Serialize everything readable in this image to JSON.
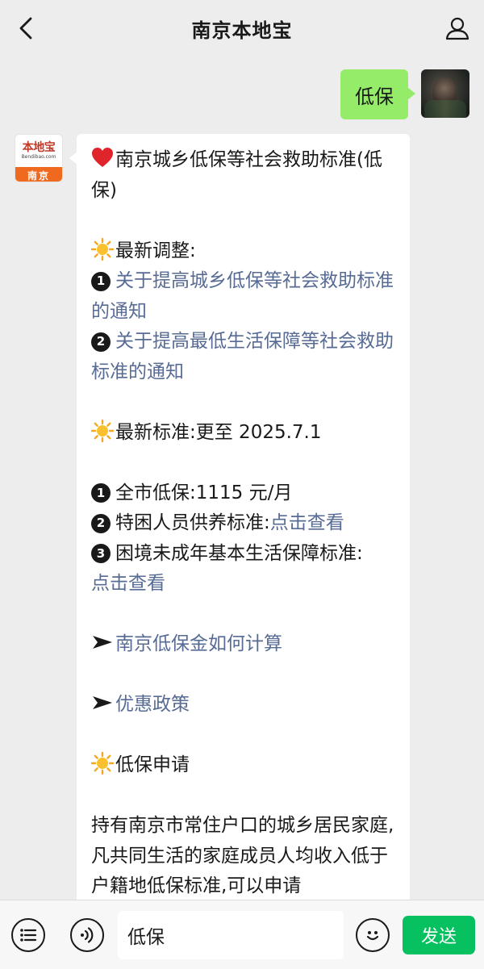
{
  "header": {
    "title": "南京本地宝"
  },
  "outgoing": {
    "text": "低保"
  },
  "brand_avatar": {
    "logo_text": "本地宝",
    "logo_sub": "Bendibao.com",
    "city": "南京"
  },
  "article": {
    "title": "南京城乡低保等社会救助标准(低保)",
    "section1_heading": "最新调整:",
    "adjust_1_num": "1",
    "adjust_1_link": "关于提高城乡低保等社会救助标准的通知",
    "adjust_2_num": "2",
    "adjust_2_link": "关于提高最低生活保障等社会救助标准的通知",
    "section2_heading": "最新标准:更至 2025.7.1",
    "std_1_num": "1",
    "std_1_text": "全市低保:1115 元/月",
    "std_2_num": "2",
    "std_2_text": "特困人员供养标准:",
    "std_2_link": "点击查看",
    "std_3_num": "3",
    "std_3_text": "困境未成年基本生活保障标准:",
    "std_3_link": "点击查看",
    "arrow_link_1": "南京低保金如何计算",
    "arrow_link_2": "优惠政策",
    "section3_heading": "低保申请",
    "paragraph": "持有南京市常住户口的城乡居民家庭,凡共同生活的家庭成员人均收入低于户籍地低保标准,可以申请"
  },
  "input_bar": {
    "text": "低保",
    "send_label": "发送"
  },
  "colors": {
    "link": "#576b95",
    "bubble_out": "#95ec69",
    "send": "#07c160"
  }
}
